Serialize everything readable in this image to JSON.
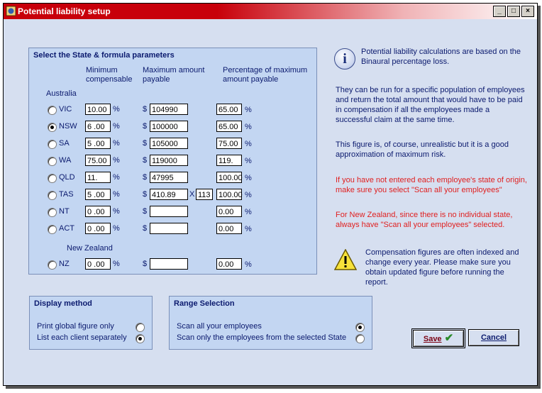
{
  "window": {
    "title": "Potential liability setup",
    "buttons": {
      "minimize": "_",
      "maximize": "□",
      "close": "×"
    }
  },
  "state_panel": {
    "title": "Select the State & formula parameters",
    "headers": {
      "min": "Minimum\ncompensable",
      "max": "Maximum amount\npayable",
      "pct": "Percentage of maximum\namount payable"
    },
    "group_australia": "Australia",
    "group_nz": "New Zealand",
    "currency": "$",
    "percent": "%",
    "rows": [
      {
        "state": "VIC",
        "selected": false,
        "min": "10.00",
        "max": "104990",
        "pct": "65.00"
      },
      {
        "state": "NSW",
        "selected": true,
        "min": "6 .00",
        "max": "100000",
        "pct": "65.00"
      },
      {
        "state": "SA",
        "selected": false,
        "min": "5 .00",
        "max": "105000",
        "pct": "75.00"
      },
      {
        "state": "WA",
        "selected": false,
        "min": "75.00",
        "max": "119000",
        "pct": "119."
      },
      {
        "state": "QLD",
        "selected": false,
        "min": "11.",
        "max": "47995",
        "pct": "100.00"
      },
      {
        "state": "TAS",
        "selected": false,
        "min": "5 .00",
        "max": "410.89",
        "multiplier_label": "X",
        "multiplier": "113",
        "pct": "100.00"
      },
      {
        "state": "NT",
        "selected": false,
        "min": "0 .00",
        "max": "",
        "pct": "0.00"
      },
      {
        "state": "ACT",
        "selected": false,
        "min": "0 .00",
        "max": "",
        "pct": "0.00"
      },
      {
        "state": "NZ",
        "selected": false,
        "min": "0 .00",
        "max": "",
        "pct": "0.00"
      }
    ]
  },
  "info": {
    "p1": "Potential liability calculations are based on the Binaural percentage loss.",
    "p2": "They can be run for a specific population of employees and return the total amount that would have to be paid in compensation if all the employees made a successful claim at the same time.",
    "p3": "This figure is, of course, unrealistic but it is a good approximation of maximum risk.",
    "p4": "If you have not entered each employee's state of origin, make sure you select \"Scan all your employees\"",
    "p5": "For New Zealand, since there is no individual state, always have \"Scan all your employees\" selected.",
    "p6": "Compensation figures are often indexed and change every year. Please make sure you obtain updated figure before running the report."
  },
  "display_method": {
    "title": "Display method",
    "options": [
      {
        "label": "Print global figure only",
        "selected": false
      },
      {
        "label": "List each client separately",
        "selected": true
      }
    ]
  },
  "range_selection": {
    "title": "Range Selection",
    "options": [
      {
        "label": "Scan all your employees",
        "selected": true
      },
      {
        "label": "Scan only the employees from the selected State",
        "selected": false
      }
    ]
  },
  "buttons": {
    "save": "Save",
    "cancel": "Cancel"
  },
  "colors": {
    "title_bar": "#c8000a",
    "panel": "#c3d6f2",
    "window_bg": "#d6dff0",
    "text": "#0b1a6e",
    "warning_text": "#e02020"
  }
}
